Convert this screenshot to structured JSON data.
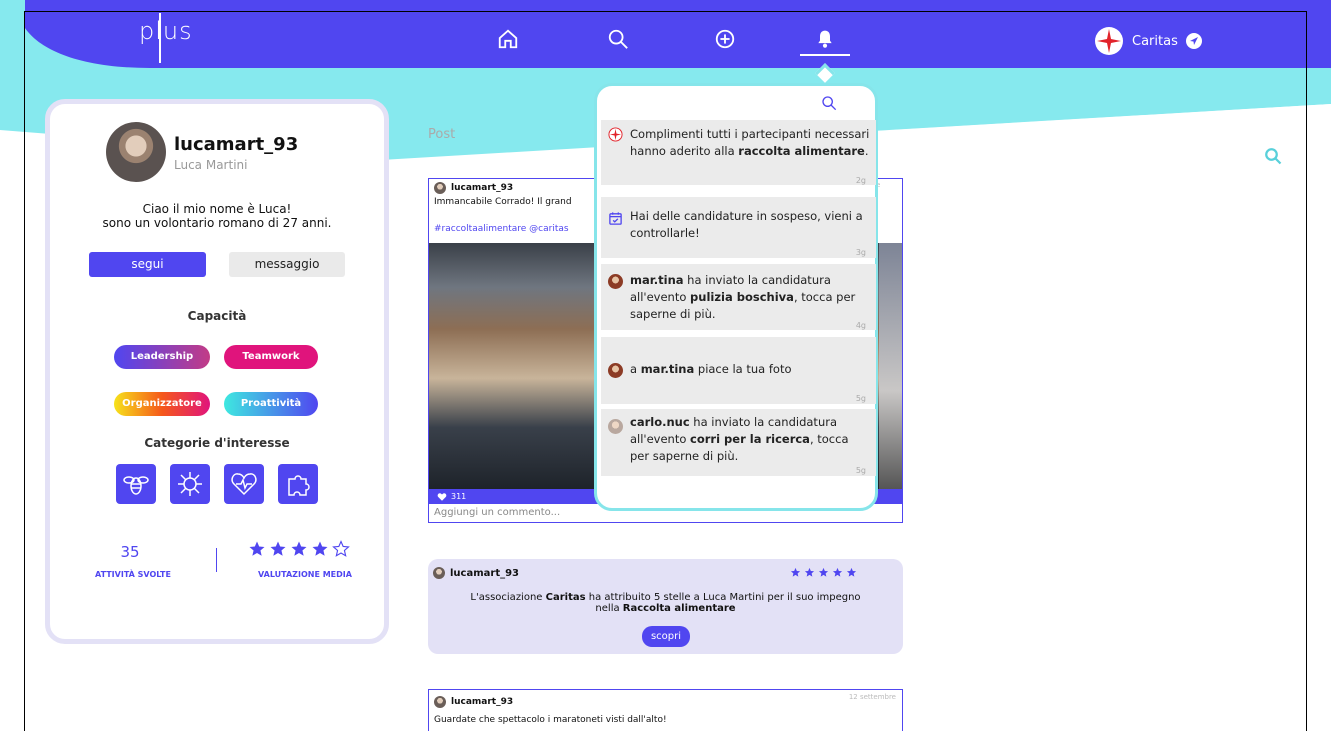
{
  "header": {
    "logo": "plus",
    "nav": [
      {
        "name": "home",
        "icon": "home-icon"
      },
      {
        "name": "search",
        "icon": "search-icon"
      },
      {
        "name": "create",
        "icon": "plus-circle-icon"
      },
      {
        "name": "notifications",
        "icon": "bell-icon",
        "active": true
      }
    ],
    "account_name": "Caritas",
    "colors": {
      "primary": "#5046f0",
      "accent": "#86e5ea"
    }
  },
  "profile": {
    "username": "lucamart_93",
    "fullname": "Luca Martini",
    "bio_line1": "Ciao il mio nome è Luca!",
    "bio_line2": "sono un volontario romano di 27 anni.",
    "follow_label": "segui",
    "message_label": "messaggio",
    "skills_title": "Capacità",
    "skills": [
      "Leadership",
      "Teamwork",
      "Organizzatore",
      "Proattività"
    ],
    "interests_title": "Categorie d'interesse",
    "interests": [
      "bee-icon",
      "virus-icon",
      "heart-pulse-icon",
      "puzzle-icon"
    ],
    "activities_count": "35",
    "activities_label": "ATTIVITÀ SVOLTE",
    "rating_label": "VALUTAZIONE MEDIA",
    "rating": 4,
    "rating_max": 5
  },
  "feed": {
    "section_label": "Post",
    "post1": {
      "user": "lucamart_93",
      "text": "Immancabile Corrado! Il grand",
      "tags": "#raccoltaalimentare @caritas",
      "likes": "311",
      "comment_placeholder": "Aggiungi un commento..."
    },
    "rating_card": {
      "user": "lucamart_93",
      "stars": 5,
      "text_a": "L'associazione ",
      "org": "Caritas",
      "text_b": " ha attribuito 5 stelle a Luca Martini per il suo impegno",
      "text_c": "nella ",
      "event": "Raccolta alimentare",
      "button": "scopri"
    },
    "post2": {
      "user": "lucamart_93",
      "date": "12 settembre",
      "text": "Guardate che spettacolo i maratoneti visti dall'alto!"
    }
  },
  "notifications": [
    {
      "icon": "caritas-icon",
      "parts": [
        "Complimenti tutti i partecipanti necessari hanno aderito alla ",
        "raccolta alimentare",
        "."
      ],
      "time": "2g"
    },
    {
      "icon": "calendar-check-icon",
      "parts": [
        "Hai delle candidature in sospeso, vieni a controllarle!",
        "",
        ""
      ],
      "time": "3g"
    },
    {
      "icon": "avatar-tina",
      "parts": [
        "mar.tina",
        " ha inviato la candidatura all'evento ",
        "pulizia boschiva",
        ", tocca per saperne di più."
      ],
      "time": "4g"
    },
    {
      "icon": "avatar-tina",
      "parts": [
        "a ",
        "mar.tina",
        " piace la tua foto"
      ],
      "time": "5g"
    },
    {
      "icon": "avatar-carlo",
      "parts": [
        "carlo.nuc",
        " ha inviato la candidatura all'evento ",
        "corri per la ricerca",
        ", tocca per saperne di più."
      ],
      "time": "5g"
    }
  ]
}
